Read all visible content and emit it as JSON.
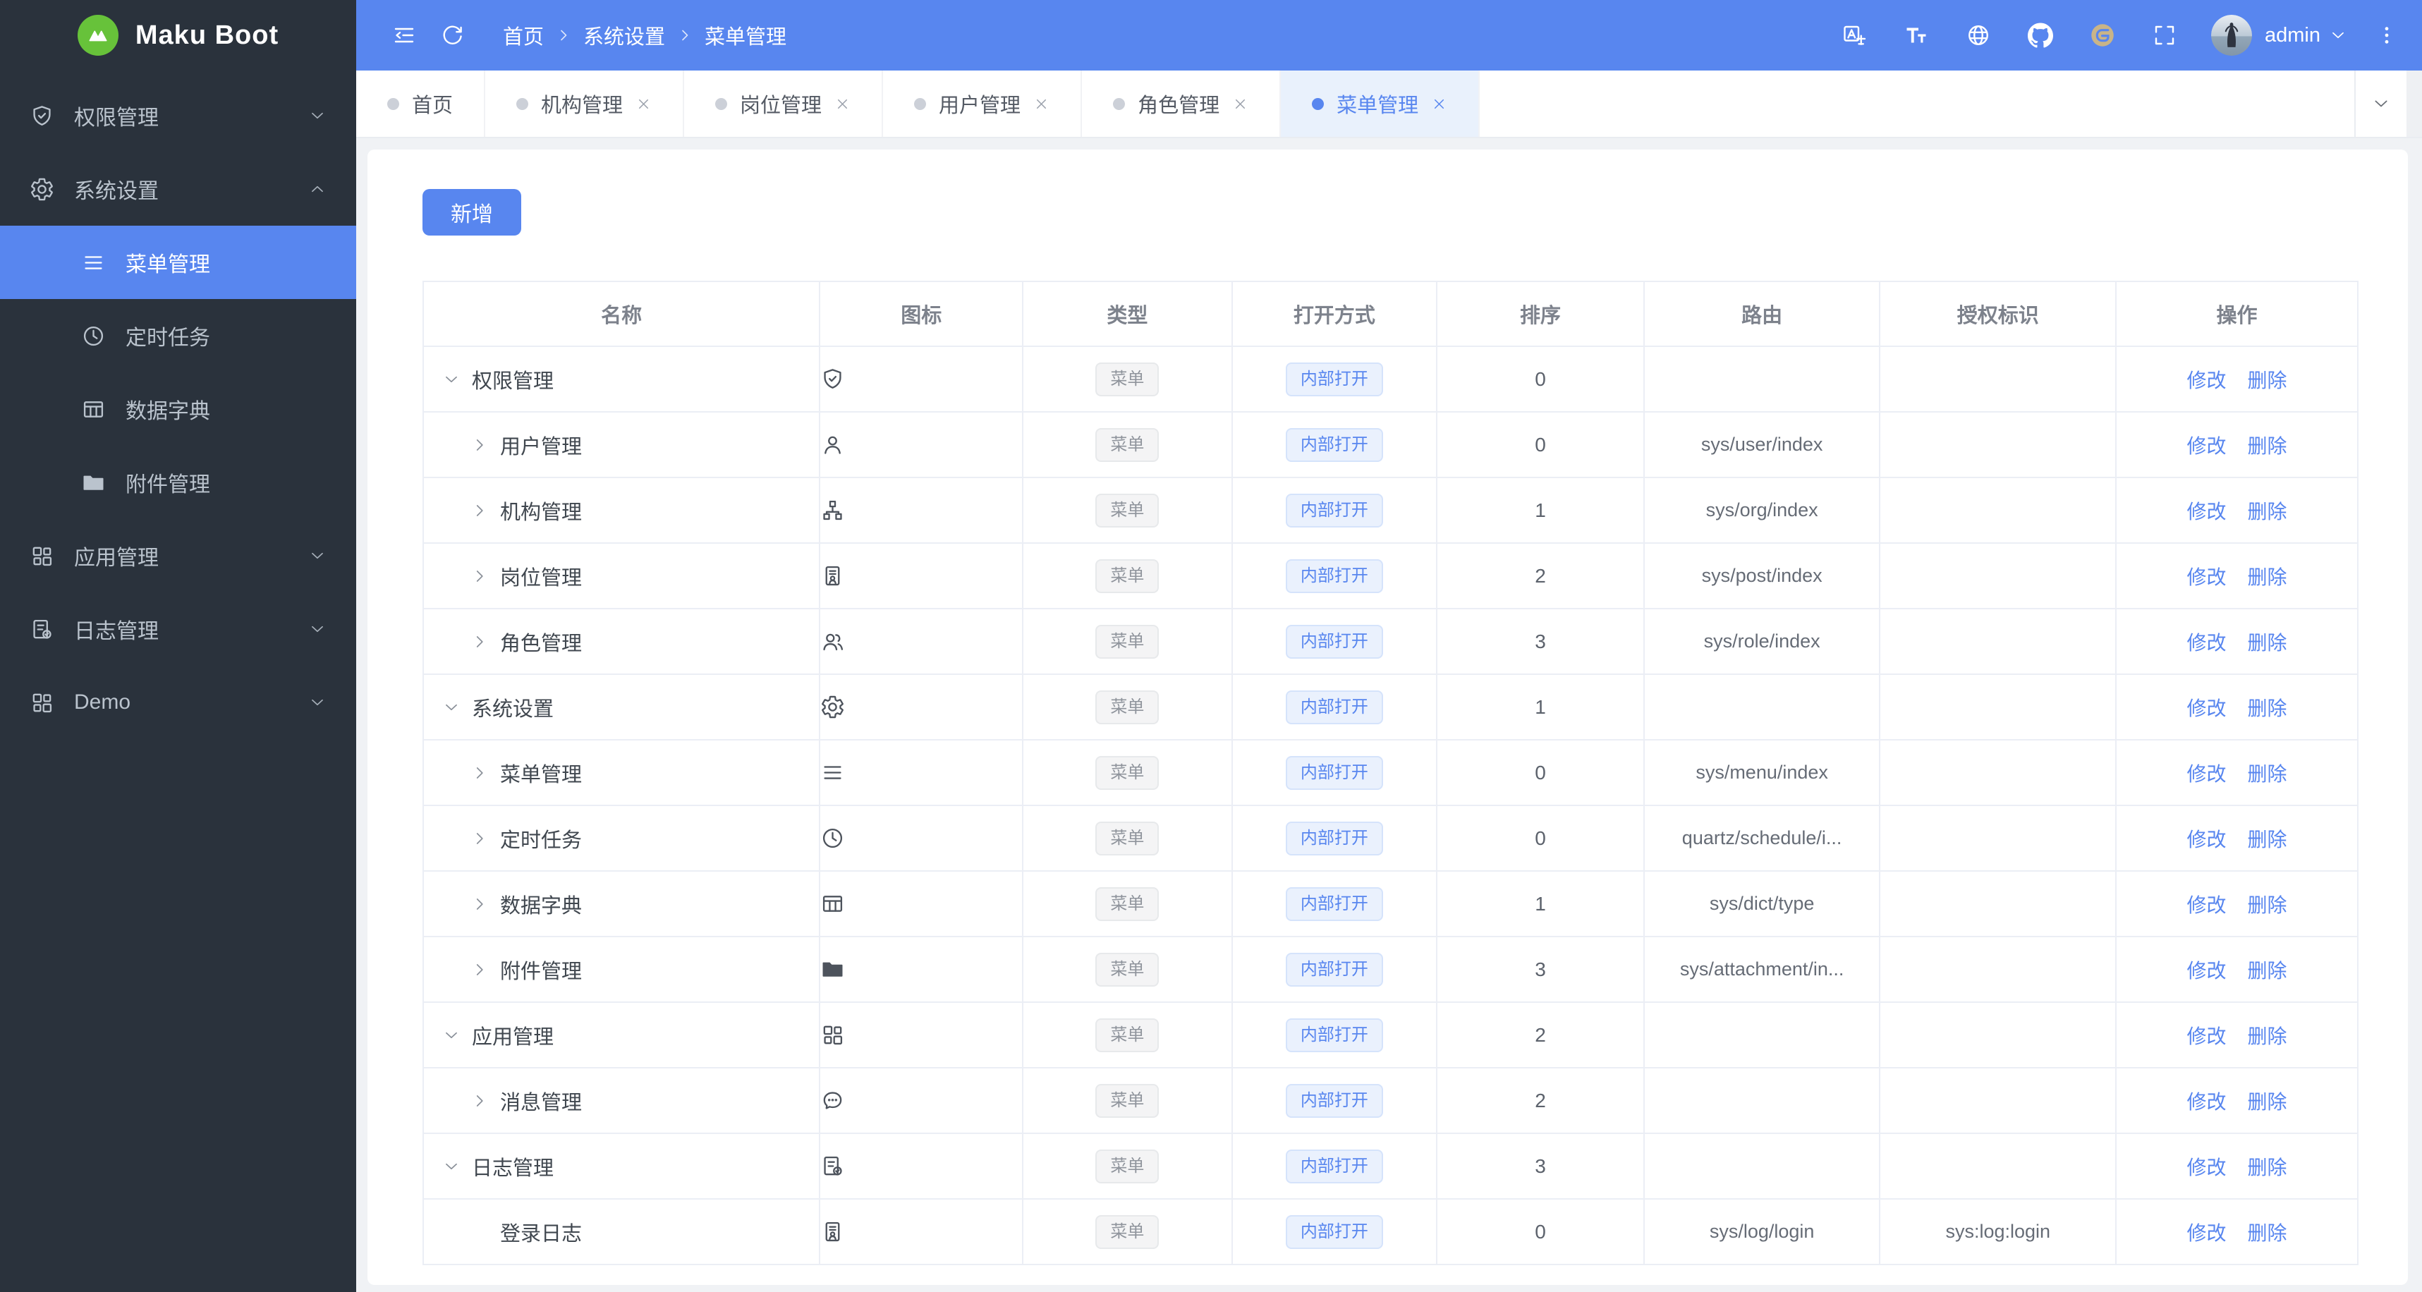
{
  "app": {
    "title": "Maku Boot"
  },
  "colors": {
    "accent": "#5886ef",
    "topbar_bg": "#5886ef",
    "sidebar_bg": "#2a323c",
    "sidebar_text": "#bac3cd",
    "content_bg": "#f0f2f5",
    "table_border": "#ebeef5",
    "logo_green": "#67c23a",
    "tab_active_bg": "#e9f1fc",
    "tag_info_bg": "#f4f4f5",
    "tag_info_text": "#8f949c",
    "tag_info_border": "#e7e9eb",
    "tag_primary_bg": "#eaf1fd",
    "tag_primary_border": "#d5e3fb",
    "link": "#5886ef"
  },
  "sidebar": {
    "logo_text": "Maku Boot",
    "items": [
      {
        "key": "permission",
        "label": "权限管理",
        "icon": "shield-icon",
        "chevron": "down"
      },
      {
        "key": "system",
        "label": "系统设置",
        "icon": "gear-icon",
        "chevron": "up",
        "expanded": true,
        "children": [
          {
            "key": "menu",
            "label": "菜单管理",
            "icon": "menu-icon",
            "active": true
          },
          {
            "key": "schedule",
            "label": "定时任务",
            "icon": "clock-icon"
          },
          {
            "key": "dict",
            "label": "数据字典",
            "icon": "dict-icon"
          },
          {
            "key": "attachment",
            "label": "附件管理",
            "icon": "folder-icon"
          }
        ]
      },
      {
        "key": "app",
        "label": "应用管理",
        "icon": "grid-icon",
        "chevron": "down"
      },
      {
        "key": "log",
        "label": "日志管理",
        "icon": "log-icon",
        "chevron": "down"
      },
      {
        "key": "demo",
        "label": "Demo",
        "icon": "grid-icon",
        "chevron": "down"
      }
    ]
  },
  "topbar": {
    "breadcrumb": [
      "首页",
      "系统设置",
      "菜单管理"
    ],
    "action_icons": [
      {
        "key": "translate",
        "icon": "translate-icon"
      },
      {
        "key": "font-size",
        "icon": "font-size-icon"
      },
      {
        "key": "globe",
        "icon": "globe-icon"
      },
      {
        "key": "github",
        "icon": "github-icon"
      },
      {
        "key": "gitee",
        "icon": "gitee-icon"
      },
      {
        "key": "fullscreen",
        "icon": "fullscreen-icon"
      }
    ],
    "username": "admin"
  },
  "tabs": [
    {
      "key": "home",
      "label": "首页",
      "closable": false
    },
    {
      "key": "org",
      "label": "机构管理",
      "closable": true
    },
    {
      "key": "post",
      "label": "岗位管理",
      "closable": true
    },
    {
      "key": "user",
      "label": "用户管理",
      "closable": true
    },
    {
      "key": "role",
      "label": "角色管理",
      "closable": true
    },
    {
      "key": "menu",
      "label": "菜单管理",
      "closable": true,
      "active": true
    }
  ],
  "toolbar": {
    "add_label": "新增"
  },
  "table": {
    "headers": [
      "名称",
      "图标",
      "类型",
      "打开方式",
      "排序",
      "路由",
      "授权标识",
      "操作"
    ],
    "edit_label": "修改",
    "delete_label": "删除",
    "rows": [
      {
        "key": "permission",
        "name": "权限管理",
        "level": 0,
        "toggle": "expanded",
        "icon": "shield-icon",
        "type": "菜单",
        "open": "内部打开",
        "sort": "0",
        "route": "",
        "auth": ""
      },
      {
        "key": "user",
        "name": "用户管理",
        "level": 1,
        "toggle": "collapsed",
        "icon": "user-icon",
        "type": "菜单",
        "open": "内部打开",
        "sort": "0",
        "route": "sys/user/index",
        "auth": ""
      },
      {
        "key": "org",
        "name": "机构管理",
        "level": 1,
        "toggle": "collapsed",
        "icon": "org-icon",
        "type": "菜单",
        "open": "内部打开",
        "sort": "1",
        "route": "sys/org/index",
        "auth": ""
      },
      {
        "key": "post",
        "name": "岗位管理",
        "level": 1,
        "toggle": "collapsed",
        "icon": "badge-icon",
        "type": "菜单",
        "open": "内部打开",
        "sort": "2",
        "route": "sys/post/index",
        "auth": ""
      },
      {
        "key": "role",
        "name": "角色管理",
        "level": 1,
        "toggle": "collapsed",
        "icon": "role-icon",
        "type": "菜单",
        "open": "内部打开",
        "sort": "3",
        "route": "sys/role/index",
        "auth": ""
      },
      {
        "key": "system",
        "name": "系统设置",
        "level": 0,
        "toggle": "expanded",
        "icon": "gear-icon",
        "type": "菜单",
        "open": "内部打开",
        "sort": "1",
        "route": "",
        "auth": ""
      },
      {
        "key": "menu",
        "name": "菜单管理",
        "level": 1,
        "toggle": "collapsed",
        "icon": "menu-icon",
        "type": "菜单",
        "open": "内部打开",
        "sort": "0",
        "route": "sys/menu/index",
        "auth": ""
      },
      {
        "key": "schedule",
        "name": "定时任务",
        "level": 1,
        "toggle": "collapsed",
        "icon": "clock-icon",
        "type": "菜单",
        "open": "内部打开",
        "sort": "0",
        "route": "quartz/schedule/i...",
        "auth": ""
      },
      {
        "key": "dict",
        "name": "数据字典",
        "level": 1,
        "toggle": "collapsed",
        "icon": "dict-icon",
        "type": "菜单",
        "open": "内部打开",
        "sort": "1",
        "route": "sys/dict/type",
        "auth": ""
      },
      {
        "key": "attachment",
        "name": "附件管理",
        "level": 1,
        "toggle": "collapsed",
        "icon": "folder-icon",
        "type": "菜单",
        "open": "内部打开",
        "sort": "3",
        "route": "sys/attachment/in...",
        "auth": ""
      },
      {
        "key": "app",
        "name": "应用管理",
        "level": 0,
        "toggle": "expanded",
        "icon": "grid-icon",
        "type": "菜单",
        "open": "内部打开",
        "sort": "2",
        "route": "",
        "auth": ""
      },
      {
        "key": "message",
        "name": "消息管理",
        "level": 1,
        "toggle": "collapsed",
        "icon": "message-icon",
        "type": "菜单",
        "open": "内部打开",
        "sort": "2",
        "route": "",
        "auth": ""
      },
      {
        "key": "log",
        "name": "日志管理",
        "level": 0,
        "toggle": "expanded",
        "icon": "log-icon",
        "type": "菜单",
        "open": "内部打开",
        "sort": "3",
        "route": "",
        "auth": ""
      },
      {
        "key": "login-log",
        "name": "登录日志",
        "level": 1,
        "toggle": "none",
        "icon": "badge-icon",
        "type": "菜单",
        "open": "内部打开",
        "sort": "0",
        "route": "sys/log/login",
        "auth": "sys:log:login"
      }
    ],
    "col_widths": [
      20.5,
      10.5,
      10.8,
      10.6,
      10.7,
      12.2,
      12.2,
      12.5
    ]
  }
}
